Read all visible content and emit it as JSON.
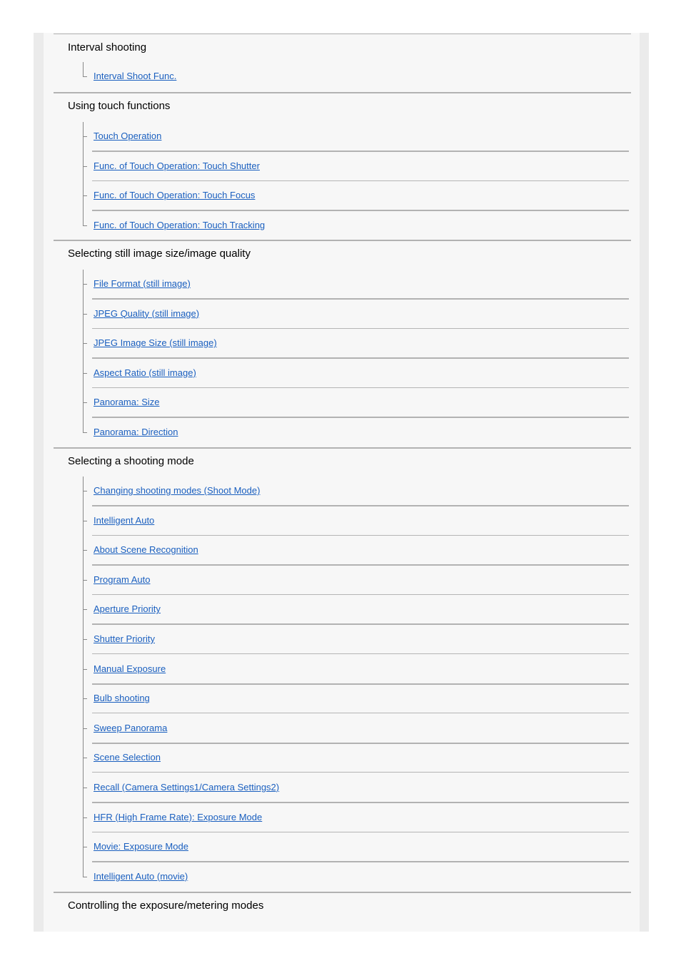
{
  "sections": [
    {
      "title": "Interval shooting",
      "items": [
        "Interval Shoot Func."
      ]
    },
    {
      "title": "Using touch functions",
      "items": [
        "Touch Operation",
        "Func. of Touch Operation: Touch Shutter",
        "Func. of Touch Operation: Touch Focus",
        "Func. of Touch Operation: Touch Tracking"
      ]
    },
    {
      "title": "Selecting still image size/image quality",
      "items": [
        "File Format (still image)",
        "JPEG Quality (still image)",
        "JPEG Image Size (still image)",
        "Aspect Ratio (still image)",
        "Panorama: Size",
        "Panorama: Direction"
      ]
    },
    {
      "title": "Selecting a shooting mode",
      "items": [
        "Changing shooting modes (Shoot Mode)",
        "Intelligent Auto",
        "About Scene Recognition",
        "Program Auto",
        "Aperture Priority",
        "Shutter Priority",
        "Manual Exposure",
        "Bulb shooting",
        "Sweep Panorama",
        "Scene Selection",
        "Recall (Camera Settings1/Camera Settings2)",
        "HFR (High Frame Rate): Exposure Mode",
        "Movie: Exposure Mode",
        "Intelligent Auto (movie)"
      ]
    },
    {
      "title": "Controlling the exposure/metering modes",
      "items": []
    }
  ],
  "colors": {
    "link": "#1a5fbf",
    "divider": "#b2b2b2",
    "background": "#f7f7f7",
    "border": "#ebebeb"
  }
}
